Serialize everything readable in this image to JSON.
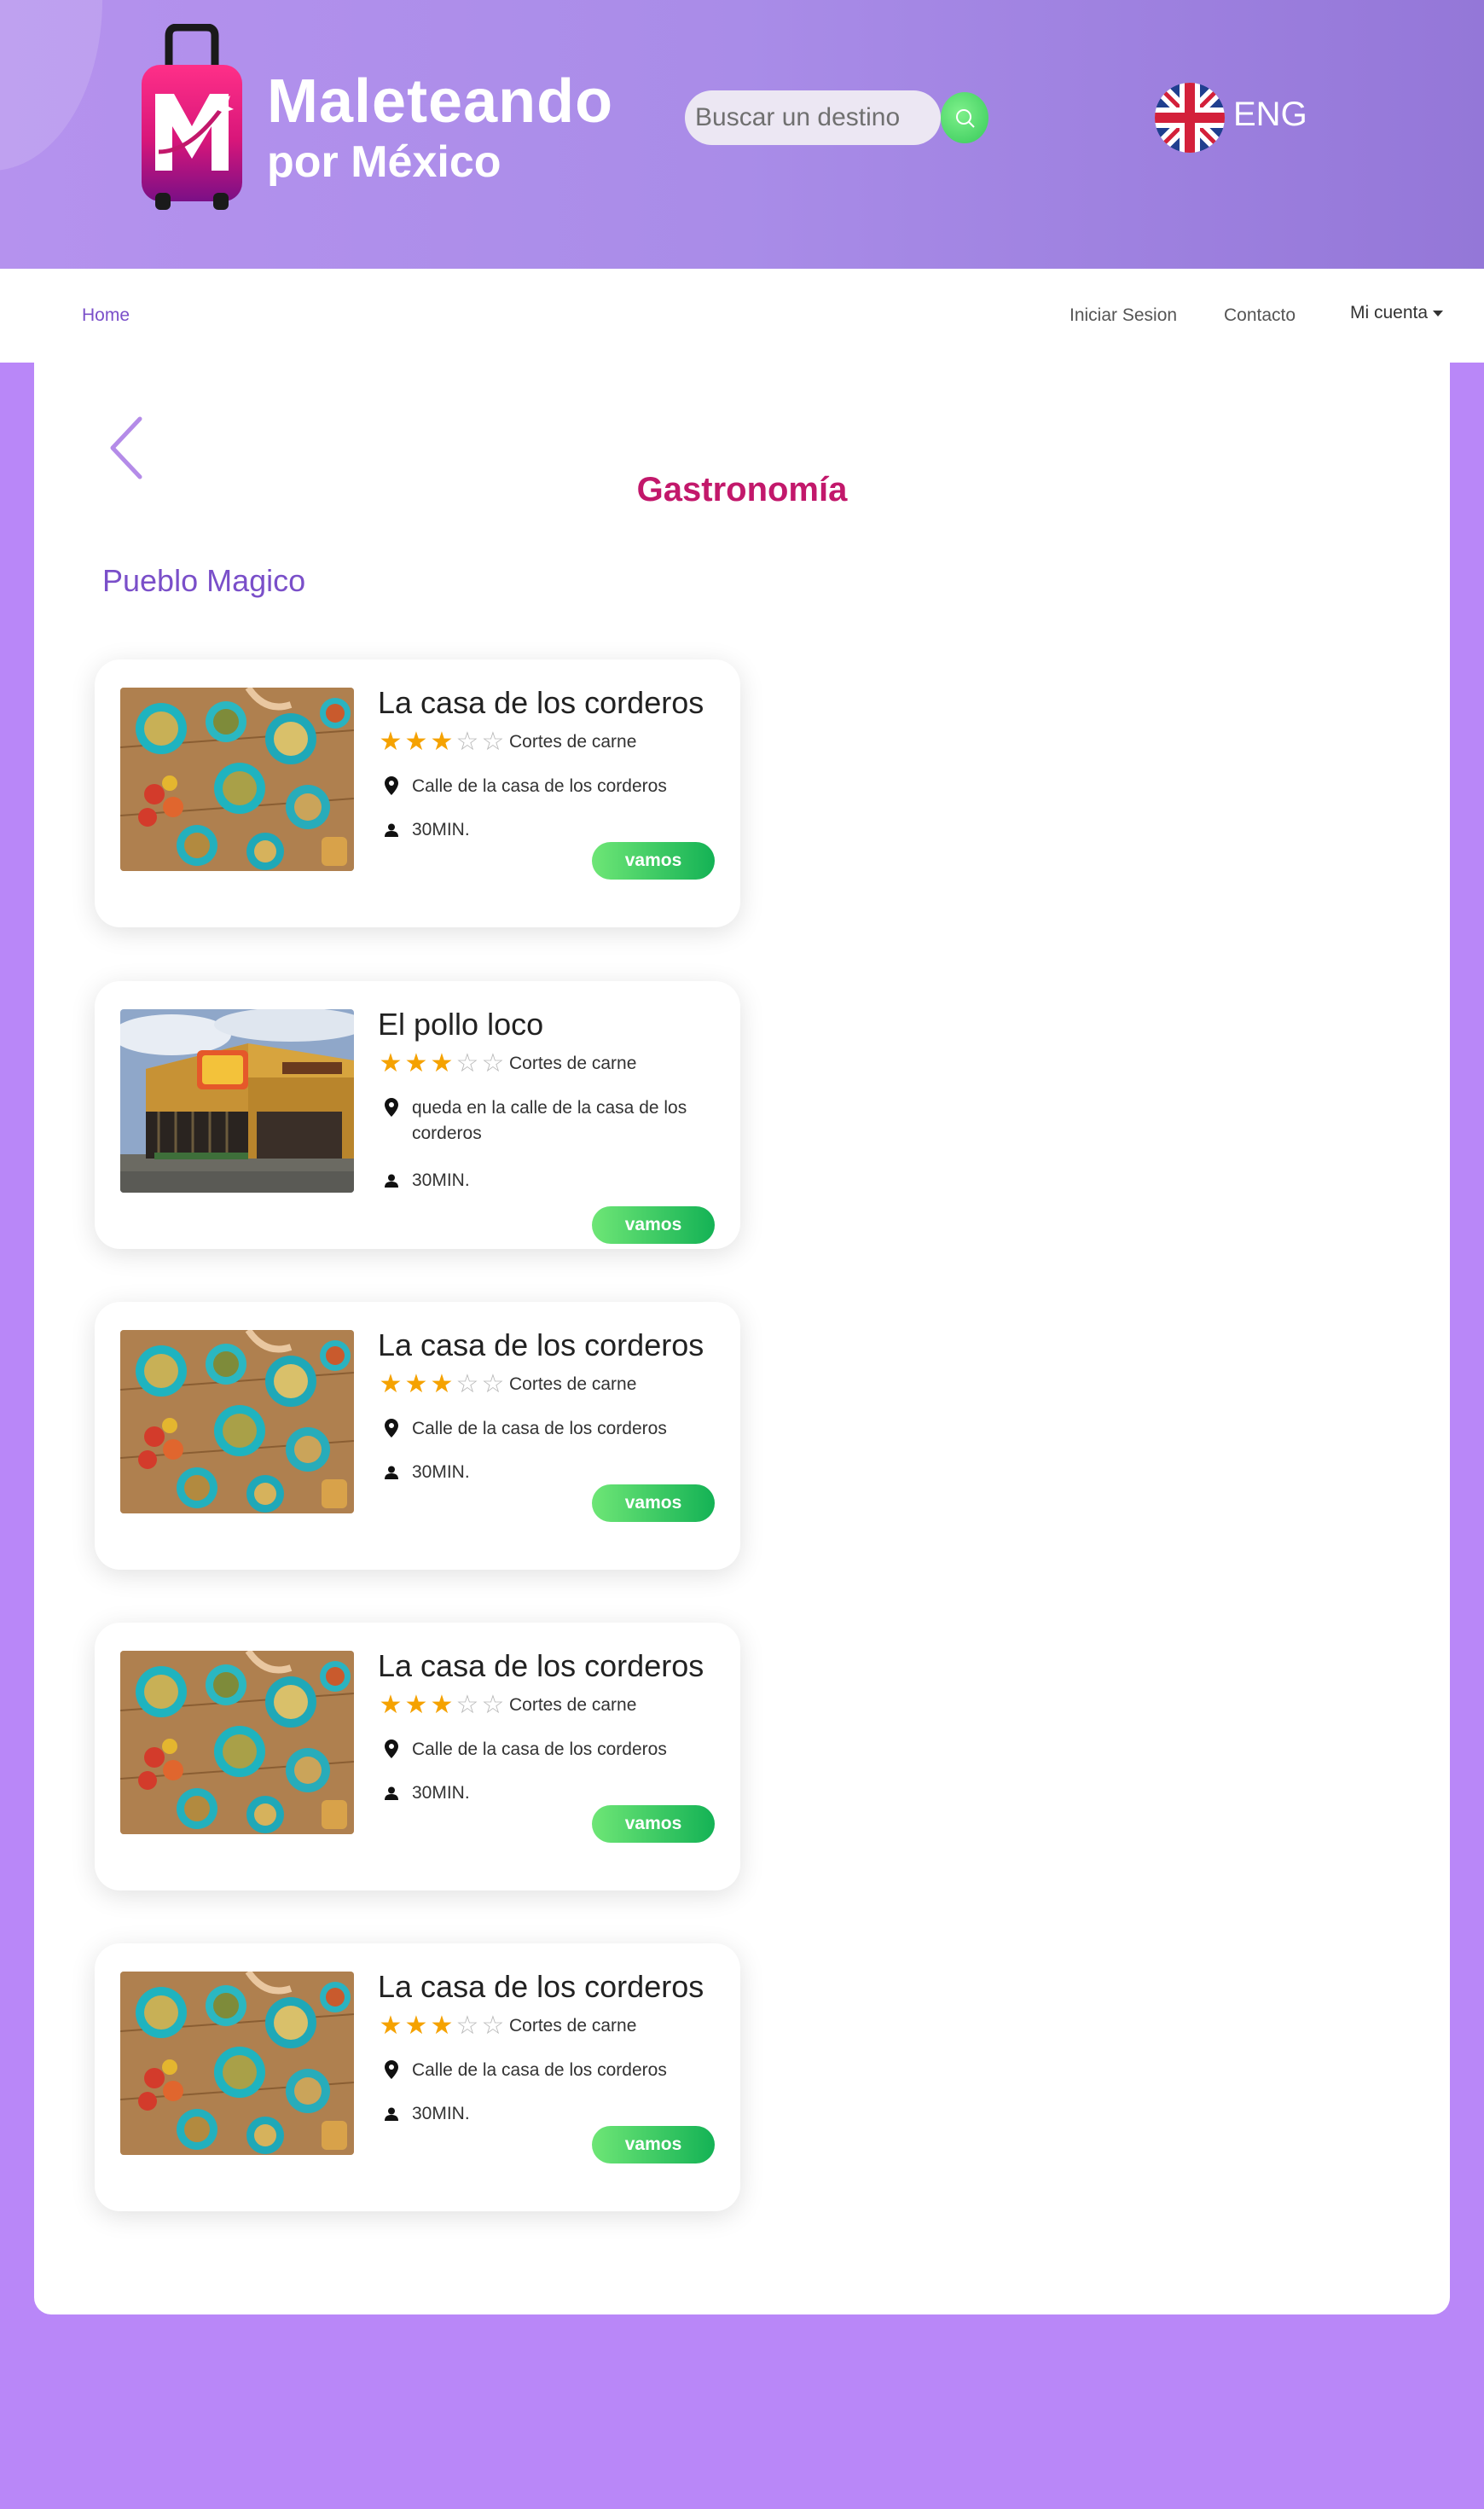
{
  "header": {
    "brand_line1": "Maleteando",
    "brand_line2": "por México",
    "search_placeholder": "Buscar un destino",
    "lang_label": "ENG"
  },
  "nav": {
    "home": "Home",
    "login": "Iniciar Sesion",
    "contact": "Contacto",
    "account": "Mi cuenta"
  },
  "page": {
    "title": "Gastronomía",
    "section": "Pueblo Magico"
  },
  "cards": [
    {
      "name": "La casa de los corderos",
      "rating": 3,
      "rating_max": 5,
      "category": "Cortes de carne",
      "address": "Calle de la casa de los corderos",
      "time": "30MIN.",
      "button": "vamos",
      "image": "food-spread-photo"
    },
    {
      "name": "El pollo loco",
      "rating": 3,
      "rating_max": 5,
      "category": "Cortes de carne",
      "address": "queda en la calle de la casa de los corderos",
      "time": "30MIN.",
      "button": "vamos",
      "image": "restaurant-building-photo"
    },
    {
      "name": "La casa de los corderos",
      "rating": 3,
      "rating_max": 5,
      "category": "Cortes de carne",
      "address": "Calle de la casa de los corderos",
      "time": "30MIN.",
      "button": "vamos",
      "image": "food-spread-photo"
    },
    {
      "name": "La casa de los corderos",
      "rating": 3,
      "rating_max": 5,
      "category": "Cortes de carne",
      "address": "Calle de la casa de los corderos",
      "time": "30MIN.",
      "button": "vamos",
      "image": "food-spread-photo"
    },
    {
      "name": "La casa de los corderos",
      "rating": 3,
      "rating_max": 5,
      "category": "Cortes de carne",
      "address": "Calle de la casa de los corderos",
      "time": "30MIN.",
      "button": "vamos",
      "image": "food-spread-photo"
    }
  ],
  "colors": {
    "accent_purple": "#7a4fc9",
    "title_magenta": "#c2186b",
    "star_gold": "#f5a200",
    "button_green": "#14b255",
    "page_background": "#b987f8"
  }
}
